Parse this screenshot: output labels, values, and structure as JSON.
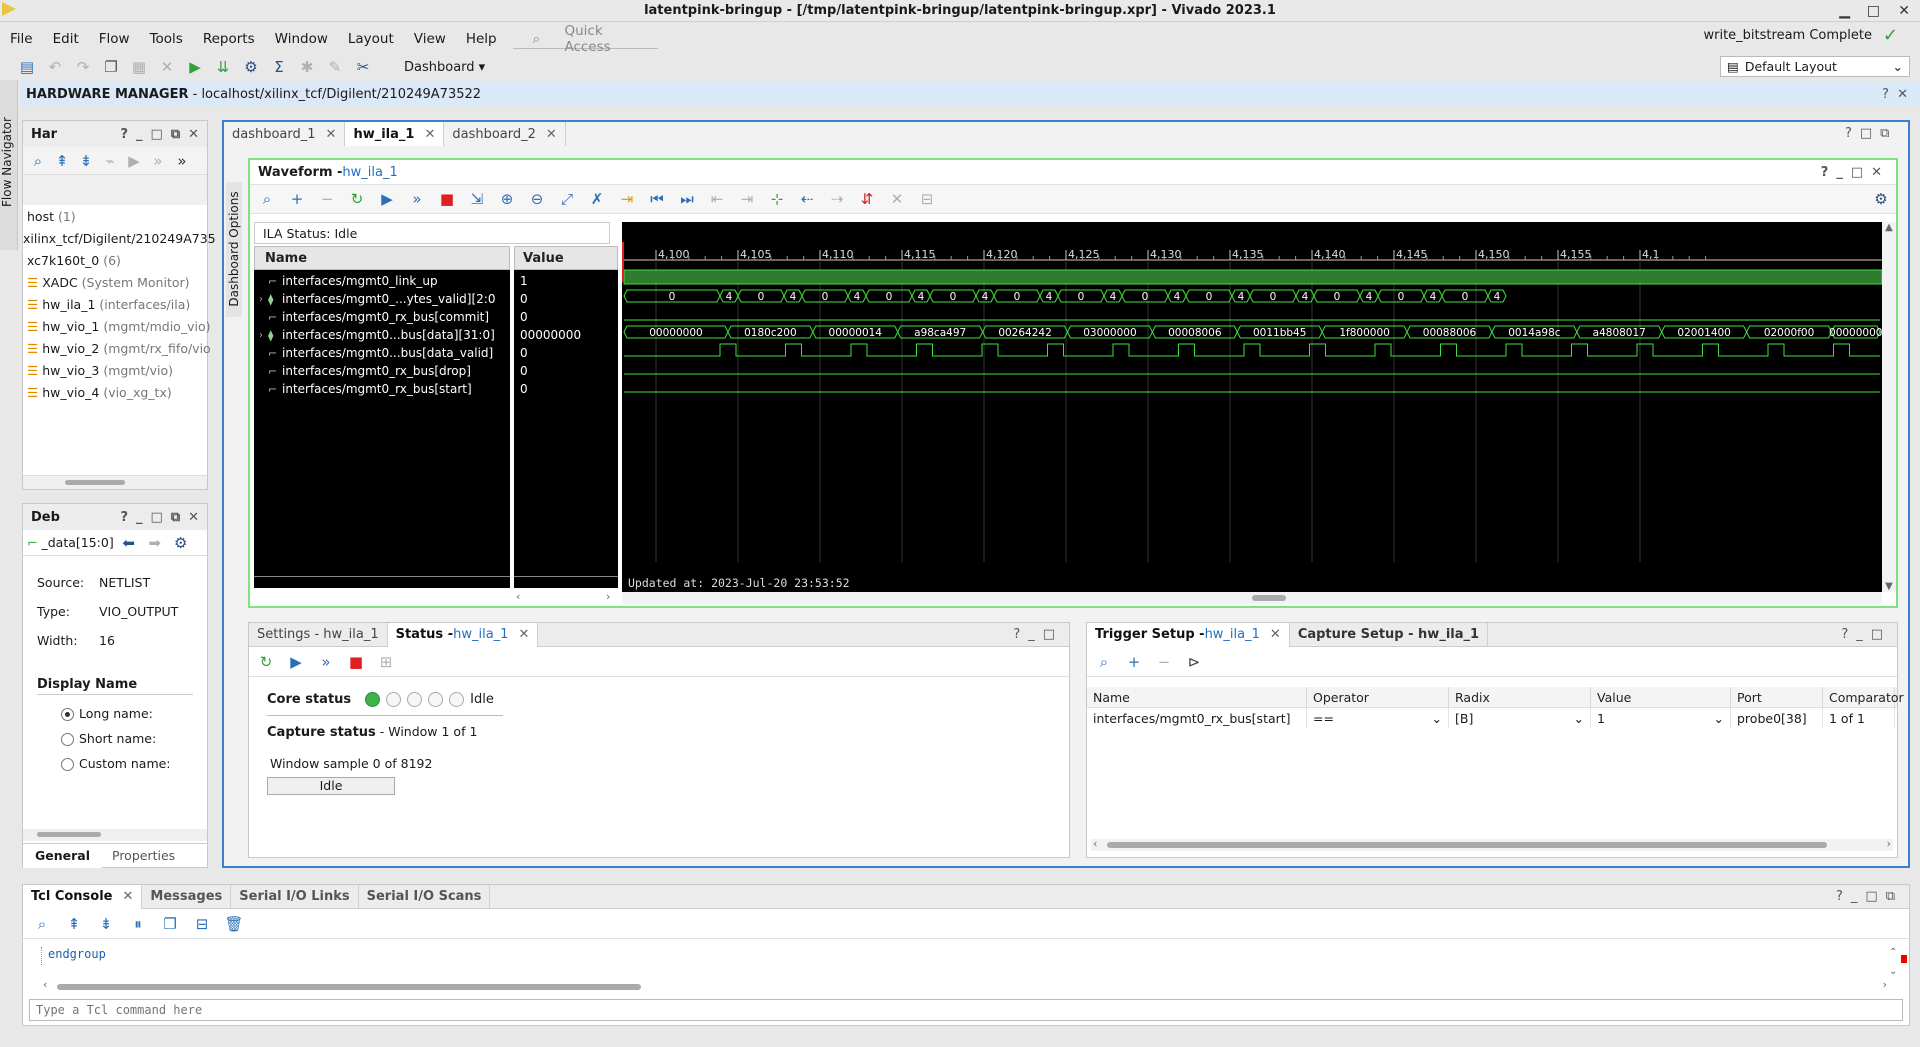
{
  "window": {
    "title": "latentpink-bringup - [/tmp/latentpink-bringup/latentpink-bringup.xpr] - Vivado 2023.1",
    "status": "write_bitstream Complete"
  },
  "menu": [
    "File",
    "Edit",
    "Flow",
    "Tools",
    "Reports",
    "Window",
    "Layout",
    "View",
    "Help"
  ],
  "quick_access": "Quick Access",
  "toolbar": {
    "dashboard": "Dashboard",
    "layout": "Default Layout"
  },
  "flow_navigator": "Flow Navigator",
  "hw_manager": {
    "label": "HARDWARE MANAGER",
    "path": "- localhost/xilinx_tcf/Digilent/210249A73522"
  },
  "hardware": {
    "title": "Har",
    "items": [
      {
        "name": "host",
        "extra": "(1)"
      },
      {
        "name": "xilinx_tcf/Digilent/210249A735",
        "extra": ""
      },
      {
        "name": "xc7k160t_0",
        "extra": "(6)"
      },
      {
        "name": "XADC",
        "extra": "(System Monitor)"
      },
      {
        "name": "hw_ila_1",
        "extra": "(interfaces/ila)"
      },
      {
        "name": "hw_vio_1",
        "extra": "(mgmt/mdio_vio)"
      },
      {
        "name": "hw_vio_2",
        "extra": "(mgmt/rx_fifo/vio"
      },
      {
        "name": "hw_vio_3",
        "extra": "(mgmt/vio)"
      },
      {
        "name": "hw_vio_4",
        "extra": "(vio_xg_tx)"
      }
    ]
  },
  "debug": {
    "title": "Deb",
    "probe": "_data[15:0]",
    "source_label": "Source:",
    "source": "NETLIST",
    "type_label": "Type:",
    "type": "VIO_OUTPUT",
    "width_label": "Width:",
    "width": "16",
    "display_name": "Display Name",
    "long": "Long name:",
    "short": "Short name:",
    "custom": "Custom name:",
    "tabs": [
      "General",
      "Properties"
    ]
  },
  "dashboard_options": "Dashboard Options",
  "editor_tabs": [
    "dashboard_1",
    "hw_ila_1",
    "dashboard_2"
  ],
  "waveform": {
    "title": "Waveform - ",
    "link": "hw_ila_1",
    "ila_status": "ILA Status: Idle",
    "col_name": "Name",
    "col_value": "Value",
    "signals": [
      {
        "name": "interfaces/mgmt0_link_up",
        "value": "1",
        "bus": false
      },
      {
        "name": "interfaces/mgmt0_...ytes_valid][2:0",
        "value": "0",
        "bus": true
      },
      {
        "name": "interfaces/mgmt0_rx_bus[commit]",
        "value": "0",
        "bus": false
      },
      {
        "name": "interfaces/mgmt0...bus[data][31:0]",
        "value": "00000000",
        "bus": true
      },
      {
        "name": "interfaces/mgmt0...bus[data_valid]",
        "value": "0",
        "bus": false
      },
      {
        "name": "interfaces/mgmt0_rx_bus[drop]",
        "value": "0",
        "bus": false
      },
      {
        "name": "interfaces/mgmt0_rx_bus[start]",
        "value": "0",
        "bus": false
      }
    ],
    "ticks": [
      "4,100",
      "4,105",
      "4,110",
      "4,115",
      "4,120",
      "4,125",
      "4,130",
      "4,135",
      "4,140",
      "4,145",
      "4,150",
      "4,155",
      "4,1"
    ],
    "bytes_valid": [
      "0",
      "4",
      "0",
      "4",
      "0",
      "4",
      "0",
      "4",
      "0",
      "4",
      "0",
      "4",
      "0",
      "4",
      "0",
      "4",
      "0",
      "4",
      "0",
      "4",
      "0",
      "4",
      "0",
      "4",
      "0",
      "4"
    ],
    "data_values": [
      "00000000",
      "0180c200",
      "00000014",
      "a98ca497",
      "00264242",
      "03000000",
      "00008006",
      "0011bb45",
      "1f800000",
      "00088006",
      "0014a98c",
      "a4808017",
      "02001400",
      "02000f00",
      "00000000"
    ],
    "updated": "Updated at: 2023-Jul-20 23:53:52"
  },
  "status_panel": {
    "tabs": [
      "Settings - hw_ila_1",
      "Status - ",
      "hw_ila_1"
    ],
    "core_status": "Core status",
    "core_state": "Idle",
    "capture_status": "Capture status",
    "window_info": "-  Window 1 of 1",
    "sample": "Window sample 0 of 8192",
    "idle_button": "Idle"
  },
  "trigger": {
    "tab1": "Trigger Setup - ",
    "tab1_link": "hw_ila_1",
    "tab2": "Capture Setup - hw_ila_1",
    "columns": [
      "Name",
      "Operator",
      "Radix",
      "Value",
      "Port",
      "Comparator"
    ],
    "row": [
      "interfaces/mgmt0_rx_bus[start]",
      "==",
      "[B]",
      "1",
      "probe0[38]",
      "1 of 1"
    ]
  },
  "console": {
    "tabs": [
      "Tcl Console",
      "Messages",
      "Serial I/O Links",
      "Serial I/O Scans"
    ],
    "output": "endgroup",
    "placeholder": "Type a Tcl command here"
  }
}
